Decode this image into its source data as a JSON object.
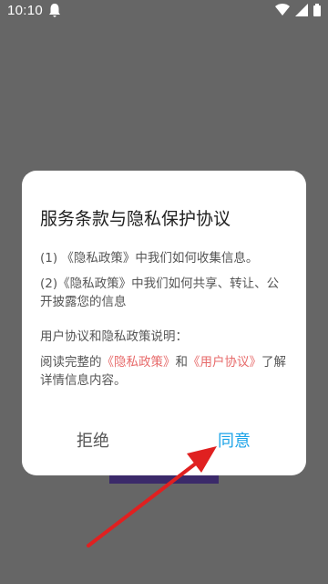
{
  "status": {
    "time": "10:10",
    "icons": [
      "notification-icon",
      "wifi-icon",
      "signal-icon",
      "battery-icon"
    ]
  },
  "dialog": {
    "title": "服务条款与隐私保护协议",
    "item1": "(1) 《隐私政策》中我们如何收集信息。",
    "item2": "(2)《隐私政策》中我们如何共享、转让、公开披露您的信息",
    "section_heading": "用户协议和隐私政策说明：",
    "read_prefix": "阅读完整的",
    "privacy_link": "《隐私政策》",
    "and": "和",
    "user_link": "《用户协议》",
    "read_suffix": "了解详情信息内容。",
    "decline_label": "拒绝",
    "agree_label": "同意"
  },
  "colors": {
    "overlay": "#666666",
    "link": "#e76a6a",
    "agree": "#1aa3e8",
    "arrow": "#e02020"
  }
}
